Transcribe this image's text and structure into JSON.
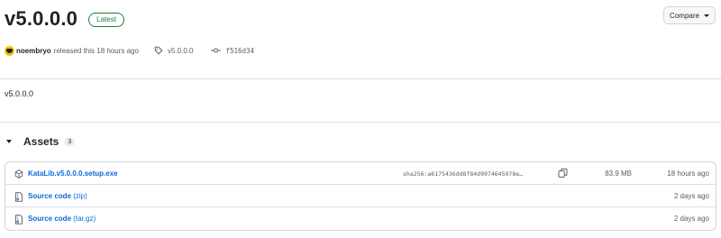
{
  "release": {
    "title": "v5.0.0.0",
    "badge": "Latest",
    "compare_label": "Compare",
    "author": "noembryo",
    "released_text": "released this 18 hours ago",
    "tag": "v5.0.0.0",
    "commit": "f516d34",
    "body": "v5.0.0.0"
  },
  "assets": {
    "title": "Assets",
    "count": "3",
    "items": [
      {
        "name": "KataLib.v5.0.0.0.setup.exe",
        "suffix": "",
        "sha": "sha256:a6175436dd8f84d9974645978e…",
        "size": "83.9 MB",
        "time": "18 hours ago",
        "icon": "package-icon"
      },
      {
        "name": "Source code",
        "suffix": " (zip)",
        "sha": "",
        "size": "",
        "time": "2 days ago",
        "icon": "file-zip-icon"
      },
      {
        "name": "Source code",
        "suffix": " (tar.gz)",
        "sha": "",
        "size": "",
        "time": "2 days ago",
        "icon": "file-zip-icon"
      }
    ]
  },
  "colors": {
    "link": "#0969da",
    "latest_green": "#1a7f37",
    "muted": "#57606a",
    "border": "#d0d7de"
  }
}
